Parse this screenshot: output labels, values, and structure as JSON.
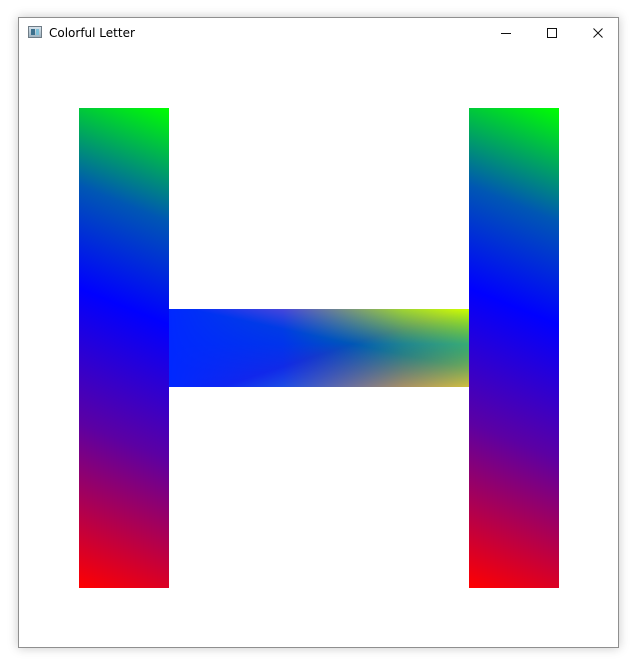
{
  "window": {
    "title": "Colorful Letter"
  },
  "icons": {
    "app": "app-icon",
    "minimize": "minimize-icon",
    "maximize": "maximize-icon",
    "close": "close-icon"
  },
  "colors": {
    "window_background": "#ffffff",
    "window_border": "#8f8f8f",
    "red": "#ff0000",
    "blue": "#0000ff",
    "green": "#00ff00"
  }
}
